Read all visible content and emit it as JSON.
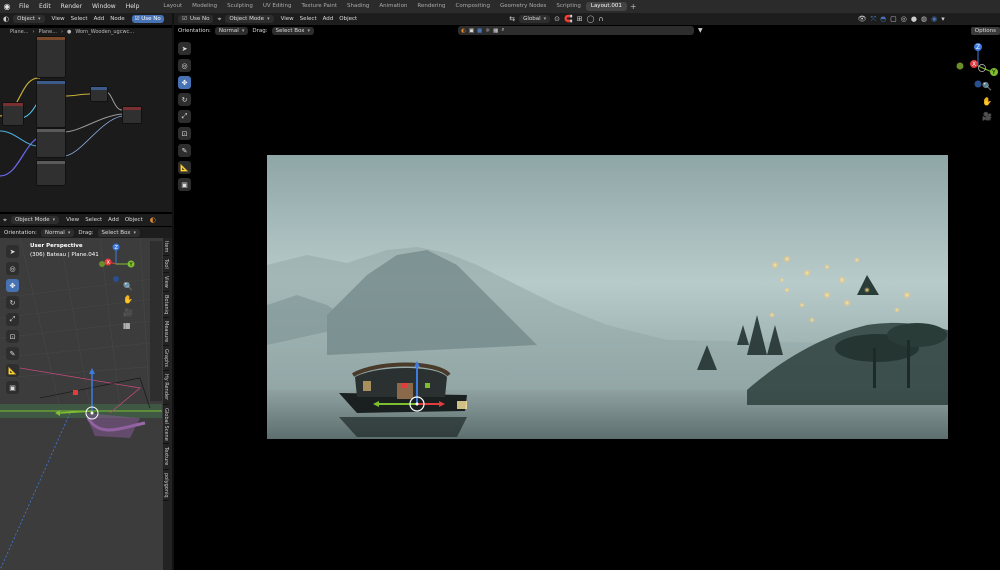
{
  "app": {
    "menu": [
      "File",
      "Edit",
      "Render",
      "Window",
      "Help"
    ],
    "workspaces": [
      "Layout",
      "Modeling",
      "Sculpting",
      "UV Editing",
      "Texture Paint",
      "Shading",
      "Animation",
      "Rendering",
      "Compositing",
      "Geometry Nodes",
      "Scripting",
      "Layout.001"
    ],
    "active_workspace": "Layout.001"
  },
  "node_editor": {
    "object_select": "Object",
    "menus": [
      "View",
      "Select",
      "Add",
      "Node"
    ],
    "use_nodes": "Use No",
    "breadcrumb": [
      "Plane...",
      "Plane...",
      "Worn_Wooden_ugcwc..."
    ]
  },
  "left_viewport": {
    "mode": "Object Mode",
    "menus": [
      "View",
      "Select",
      "Add",
      "Object"
    ],
    "orientation_label": "Orientation:",
    "orientation_value": "Normal",
    "drag_label": "Drag:",
    "drag_value": "Select Box",
    "overlay_title": "User Perspective",
    "overlay_subtitle": "(306) Bateau | Plane.041",
    "side_tabs": [
      "Item",
      "Tool",
      "View",
      "Botaniq",
      "Measure",
      "Graphs",
      "Hy Render",
      "Global Scene",
      "Texture",
      "polygoniq"
    ]
  },
  "main_viewport": {
    "mode": "Object Mode",
    "menus": [
      "View",
      "Select",
      "Add",
      "Object"
    ],
    "orientation_label": "Orientation:",
    "orientation_value": "Normal",
    "drag_label": "Drag:",
    "drag_value": "Select Box",
    "transform_orientation": "Global",
    "options_label": "Options"
  },
  "gizmo": {
    "x": "X",
    "y": "Y",
    "z": "Z"
  },
  "colors": {
    "accent": "#4772b3",
    "x_axis": "#e23c3c",
    "y_axis": "#7fbf2f",
    "z_axis": "#3d7be0"
  }
}
